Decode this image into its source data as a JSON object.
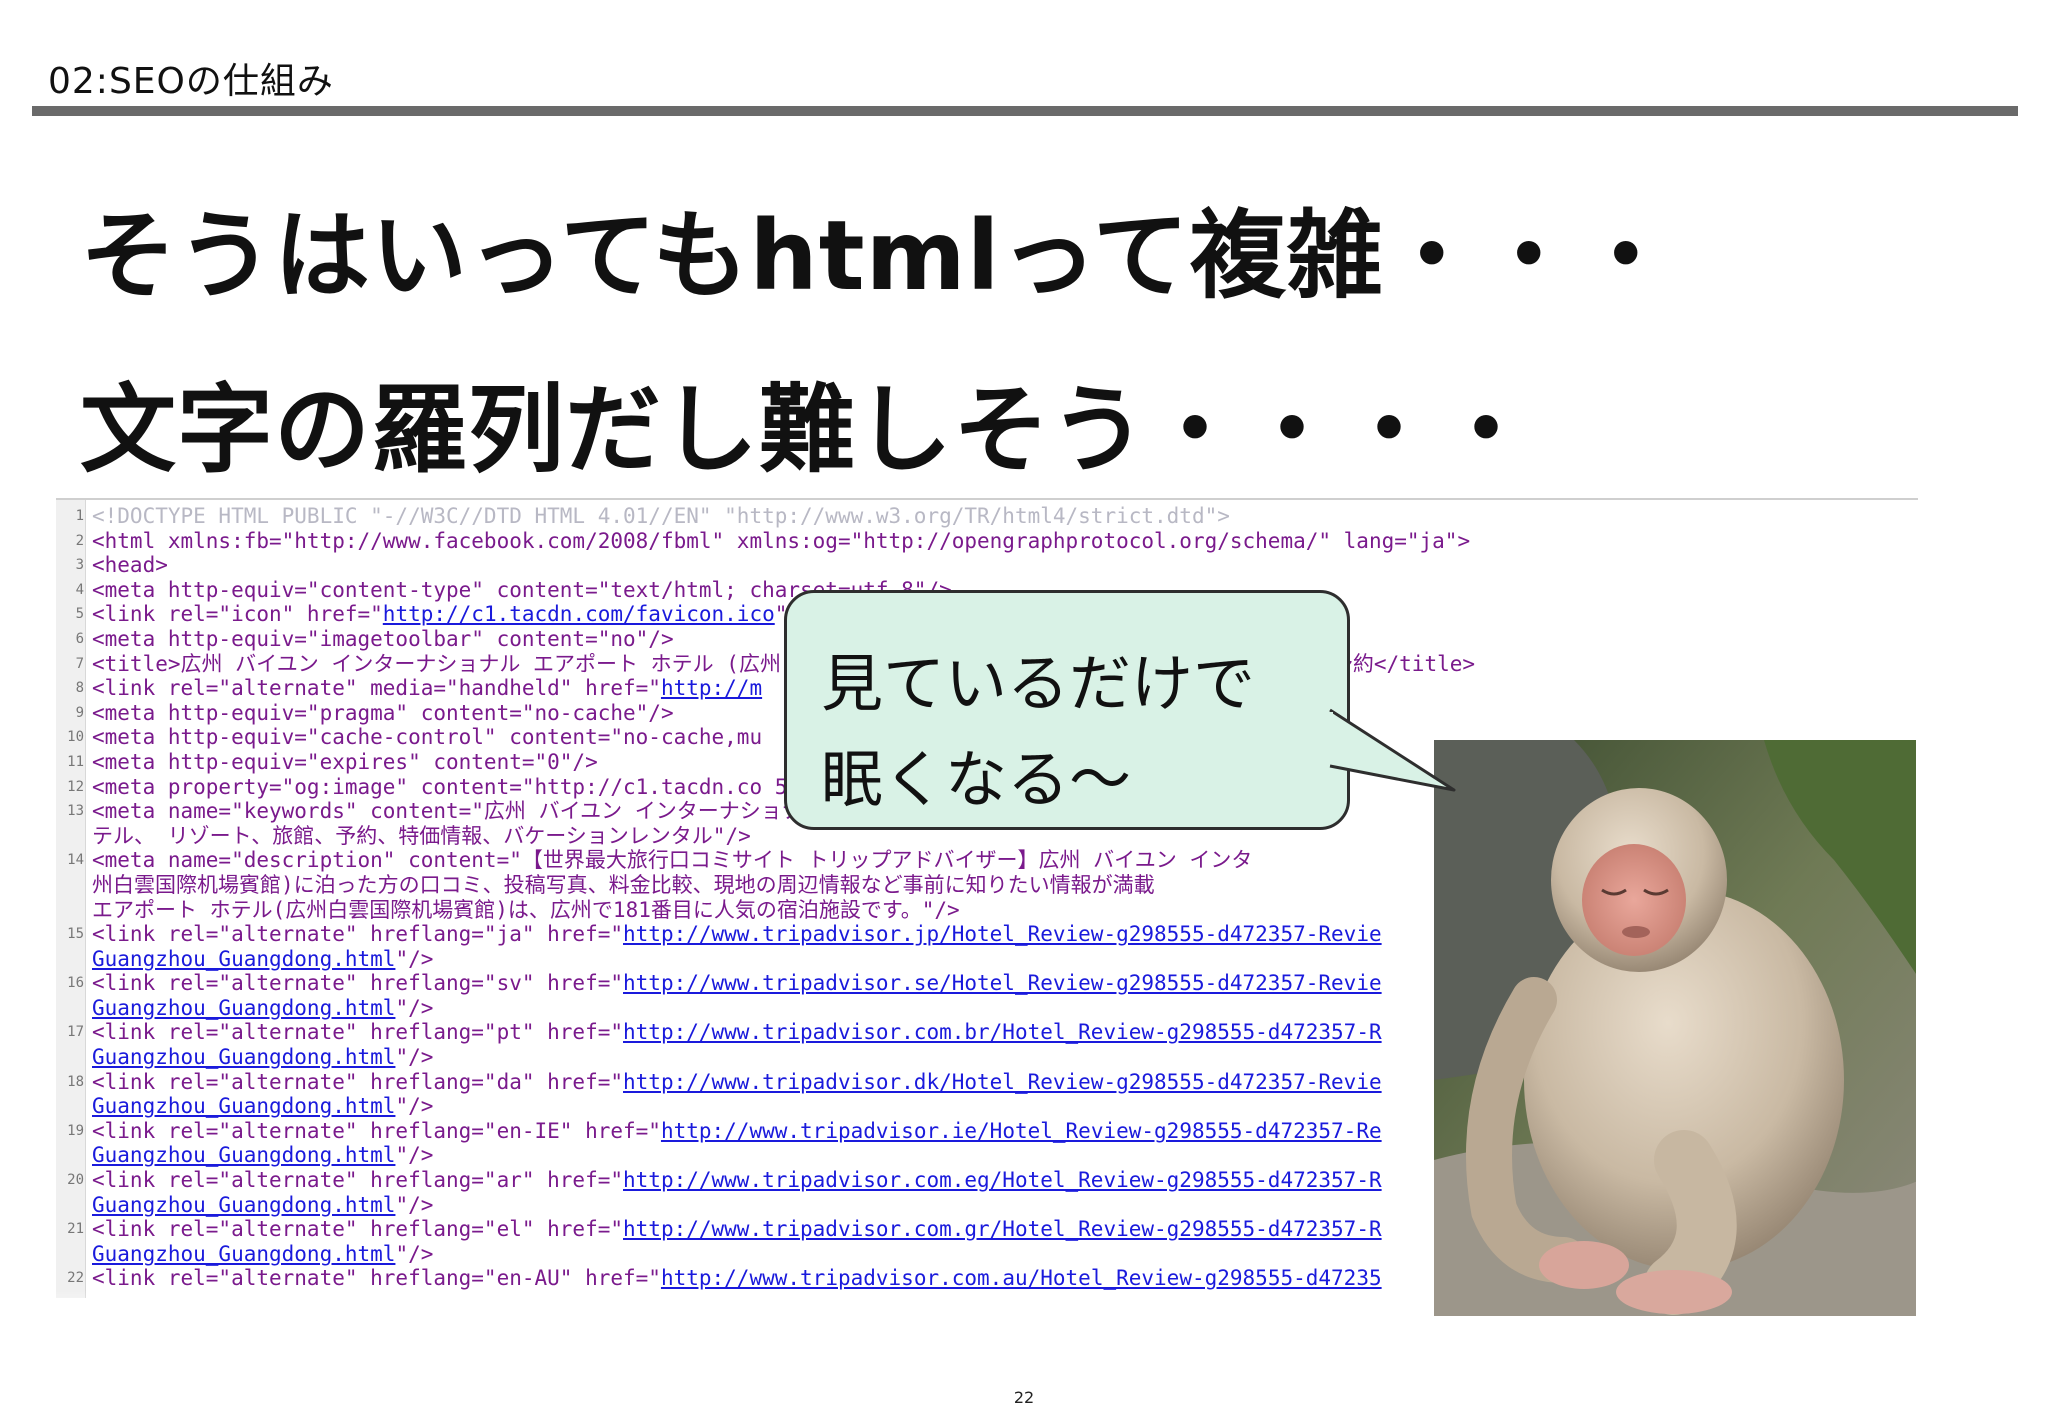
{
  "header": {
    "section_label": "02:SEOの仕組み"
  },
  "headline": {
    "line1": "そうはいってもhtmlって複雑・・・",
    "line2": "文字の羅列だし難しそう・・・・"
  },
  "code_view": {
    "lines": [
      {
        "n": "1",
        "text": "<!DOCTYPE HTML PUBLIC \"-//W3C//DTD HTML 4.01//EN\" \"http://www.w3.org/TR/html4/strict.dtd\">"
      },
      {
        "n": "2",
        "text": "<html xmlns:fb=\"http://www.facebook.com/2008/fbml\" xmlns:og=\"http://opengraphprotocol.org/schema/\" lang=\"ja\">"
      },
      {
        "n": "3",
        "text": "<head>"
      },
      {
        "n": "4",
        "text": "<meta http-equiv=\"content-type\" content=\"text/html; charset=utf-8\"/>"
      },
      {
        "n": "5",
        "pre": "<link rel=\"icon\" href=\"",
        "url": "http://c1.tacdn.com/favicon.ico",
        "post": "\"/>"
      },
      {
        "n": "6",
        "text": "<meta http-equiv=\"imagetoolbar\" content=\"no\"/>"
      },
      {
        "n": "7",
        "text": "<title>広州 バイユン インターナショナル エアポート ホテル (広州白雲国際机場賓館) (Guangzhou) -広州- 口コミ・格安予約</title>"
      },
      {
        "n": "8",
        "pre": "<link rel=\"alternate\" media=\"handheld\" href=\"",
        "url": "http://m",
        "post": ""
      },
      {
        "n": "9",
        "text": "<meta http-equiv=\"pragma\" content=\"no-cache\"/>"
      },
      {
        "n": "10",
        "text": "<meta http-equiv=\"cache-control\" content=\"no-cache,mu"
      },
      {
        "n": "11",
        "text": "<meta http-equiv=\"expires\" content=\"0\"/>"
      },
      {
        "n": "12",
        "text": "<meta property=\"og:image\" content=\"http://c1.tacdn.co                                  50px\"/>"
      },
      {
        "n": "13",
        "text": "<meta name=\"keywords\" content=\"広州 バイユン インターナショナル エアポート ホテル(広州白雲国際机場賓館"
      },
      {
        "n": "",
        "text": "テル、 リゾート、旅館、予約、特価情報、バケーションレンタル\"/>"
      },
      {
        "n": "14",
        "text": "<meta name=\"description\" content=\"【世界最大旅行口コミサイト トリップアドバイザー】広州 バイユン インタ"
      },
      {
        "n": "",
        "text": "州白雲国際机場賓館)に泊った方の口コミ、投稿写真、料金比較、現地の周辺情報など事前に知りたい情報が満載"
      },
      {
        "n": "",
        "text": "エアポート ホテル(広州白雲国際机場賓館)は、広州で181番目に人気の宿泊施設です。\"/>"
      },
      {
        "n": "15",
        "pre": "<link rel=\"alternate\" hreflang=\"ja\" href=\"",
        "url": "http://www.tripadvisor.jp/Hotel_Review-g298555-d472357-Revie",
        "post": ""
      },
      {
        "n": "",
        "tail": "Guangzhou_Guangdong.html",
        "post": "\"/>"
      },
      {
        "n": "16",
        "pre": "<link rel=\"alternate\" hreflang=\"sv\" href=\"",
        "url": "http://www.tripadvisor.se/Hotel_Review-g298555-d472357-Revie",
        "post": ""
      },
      {
        "n": "",
        "tail": "Guangzhou_Guangdong.html",
        "post": "\"/>"
      },
      {
        "n": "17",
        "pre": "<link rel=\"alternate\" hreflang=\"pt\" href=\"",
        "url": "http://www.tripadvisor.com.br/Hotel_Review-g298555-d472357-R",
        "post": ""
      },
      {
        "n": "",
        "tail": "Guangzhou_Guangdong.html",
        "post": "\"/>"
      },
      {
        "n": "18",
        "pre": "<link rel=\"alternate\" hreflang=\"da\" href=\"",
        "url": "http://www.tripadvisor.dk/Hotel_Review-g298555-d472357-Revie",
        "post": ""
      },
      {
        "n": "",
        "tail": "Guangzhou_Guangdong.html",
        "post": "\"/>"
      },
      {
        "n": "19",
        "pre": "<link rel=\"alternate\" hreflang=\"en-IE\" href=\"",
        "url": "http://www.tripadvisor.ie/Hotel_Review-g298555-d472357-Re",
        "post": ""
      },
      {
        "n": "",
        "tail": "Guangzhou_Guangdong.html",
        "post": "\"/>"
      },
      {
        "n": "20",
        "pre": "<link rel=\"alternate\" hreflang=\"ar\" href=\"",
        "url": "http://www.tripadvisor.com.eg/Hotel_Review-g298555-d472357-R",
        "post": ""
      },
      {
        "n": "",
        "tail": "Guangzhou_Guangdong.html",
        "post": "\"/>"
      },
      {
        "n": "21",
        "pre": "<link rel=\"alternate\" hreflang=\"el\" href=\"",
        "url": "http://www.tripadvisor.com.gr/Hotel_Review-g298555-d472357-R",
        "post": ""
      },
      {
        "n": "",
        "tail": "Guangzhou_Guangdong.html",
        "post": "\"/>"
      },
      {
        "n": "22",
        "pre": "<link rel=\"alternate\" hreflang=\"en-AU\" href=\"",
        "url": "http://www.tripadvisor.com.au/Hotel_Review-g298555-d47235",
        "post": ""
      }
    ]
  },
  "bubble": {
    "line1": "見ているだけで",
    "line2": "眠くなる～"
  },
  "footer": {
    "page_number": "22"
  },
  "colors": {
    "code_tag": "#7a1a8c",
    "code_link": "#1a1adc",
    "bubble_fill": "#d9f2e6",
    "rule": "#6a6a6a"
  }
}
